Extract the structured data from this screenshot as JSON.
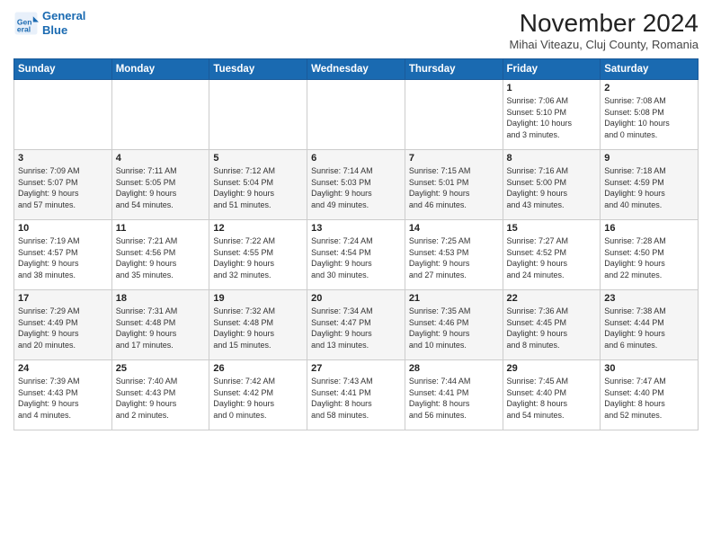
{
  "header": {
    "logo_line1": "General",
    "logo_line2": "Blue",
    "month_title": "November 2024",
    "location": "Mihai Viteazu, Cluj County, Romania"
  },
  "days_of_week": [
    "Sunday",
    "Monday",
    "Tuesday",
    "Wednesday",
    "Thursday",
    "Friday",
    "Saturday"
  ],
  "weeks": [
    {
      "days": [
        {
          "num": "",
          "info": ""
        },
        {
          "num": "",
          "info": ""
        },
        {
          "num": "",
          "info": ""
        },
        {
          "num": "",
          "info": ""
        },
        {
          "num": "",
          "info": ""
        },
        {
          "num": "1",
          "info": "Sunrise: 7:06 AM\nSunset: 5:10 PM\nDaylight: 10 hours\nand 3 minutes."
        },
        {
          "num": "2",
          "info": "Sunrise: 7:08 AM\nSunset: 5:08 PM\nDaylight: 10 hours\nand 0 minutes."
        }
      ]
    },
    {
      "days": [
        {
          "num": "3",
          "info": "Sunrise: 7:09 AM\nSunset: 5:07 PM\nDaylight: 9 hours\nand 57 minutes."
        },
        {
          "num": "4",
          "info": "Sunrise: 7:11 AM\nSunset: 5:05 PM\nDaylight: 9 hours\nand 54 minutes."
        },
        {
          "num": "5",
          "info": "Sunrise: 7:12 AM\nSunset: 5:04 PM\nDaylight: 9 hours\nand 51 minutes."
        },
        {
          "num": "6",
          "info": "Sunrise: 7:14 AM\nSunset: 5:03 PM\nDaylight: 9 hours\nand 49 minutes."
        },
        {
          "num": "7",
          "info": "Sunrise: 7:15 AM\nSunset: 5:01 PM\nDaylight: 9 hours\nand 46 minutes."
        },
        {
          "num": "8",
          "info": "Sunrise: 7:16 AM\nSunset: 5:00 PM\nDaylight: 9 hours\nand 43 minutes."
        },
        {
          "num": "9",
          "info": "Sunrise: 7:18 AM\nSunset: 4:59 PM\nDaylight: 9 hours\nand 40 minutes."
        }
      ]
    },
    {
      "days": [
        {
          "num": "10",
          "info": "Sunrise: 7:19 AM\nSunset: 4:57 PM\nDaylight: 9 hours\nand 38 minutes."
        },
        {
          "num": "11",
          "info": "Sunrise: 7:21 AM\nSunset: 4:56 PM\nDaylight: 9 hours\nand 35 minutes."
        },
        {
          "num": "12",
          "info": "Sunrise: 7:22 AM\nSunset: 4:55 PM\nDaylight: 9 hours\nand 32 minutes."
        },
        {
          "num": "13",
          "info": "Sunrise: 7:24 AM\nSunset: 4:54 PM\nDaylight: 9 hours\nand 30 minutes."
        },
        {
          "num": "14",
          "info": "Sunrise: 7:25 AM\nSunset: 4:53 PM\nDaylight: 9 hours\nand 27 minutes."
        },
        {
          "num": "15",
          "info": "Sunrise: 7:27 AM\nSunset: 4:52 PM\nDaylight: 9 hours\nand 24 minutes."
        },
        {
          "num": "16",
          "info": "Sunrise: 7:28 AM\nSunset: 4:50 PM\nDaylight: 9 hours\nand 22 minutes."
        }
      ]
    },
    {
      "days": [
        {
          "num": "17",
          "info": "Sunrise: 7:29 AM\nSunset: 4:49 PM\nDaylight: 9 hours\nand 20 minutes."
        },
        {
          "num": "18",
          "info": "Sunrise: 7:31 AM\nSunset: 4:48 PM\nDaylight: 9 hours\nand 17 minutes."
        },
        {
          "num": "19",
          "info": "Sunrise: 7:32 AM\nSunset: 4:48 PM\nDaylight: 9 hours\nand 15 minutes."
        },
        {
          "num": "20",
          "info": "Sunrise: 7:34 AM\nSunset: 4:47 PM\nDaylight: 9 hours\nand 13 minutes."
        },
        {
          "num": "21",
          "info": "Sunrise: 7:35 AM\nSunset: 4:46 PM\nDaylight: 9 hours\nand 10 minutes."
        },
        {
          "num": "22",
          "info": "Sunrise: 7:36 AM\nSunset: 4:45 PM\nDaylight: 9 hours\nand 8 minutes."
        },
        {
          "num": "23",
          "info": "Sunrise: 7:38 AM\nSunset: 4:44 PM\nDaylight: 9 hours\nand 6 minutes."
        }
      ]
    },
    {
      "days": [
        {
          "num": "24",
          "info": "Sunrise: 7:39 AM\nSunset: 4:43 PM\nDaylight: 9 hours\nand 4 minutes."
        },
        {
          "num": "25",
          "info": "Sunrise: 7:40 AM\nSunset: 4:43 PM\nDaylight: 9 hours\nand 2 minutes."
        },
        {
          "num": "26",
          "info": "Sunrise: 7:42 AM\nSunset: 4:42 PM\nDaylight: 9 hours\nand 0 minutes."
        },
        {
          "num": "27",
          "info": "Sunrise: 7:43 AM\nSunset: 4:41 PM\nDaylight: 8 hours\nand 58 minutes."
        },
        {
          "num": "28",
          "info": "Sunrise: 7:44 AM\nSunset: 4:41 PM\nDaylight: 8 hours\nand 56 minutes."
        },
        {
          "num": "29",
          "info": "Sunrise: 7:45 AM\nSunset: 4:40 PM\nDaylight: 8 hours\nand 54 minutes."
        },
        {
          "num": "30",
          "info": "Sunrise: 7:47 AM\nSunset: 4:40 PM\nDaylight: 8 hours\nand 52 minutes."
        }
      ]
    }
  ]
}
